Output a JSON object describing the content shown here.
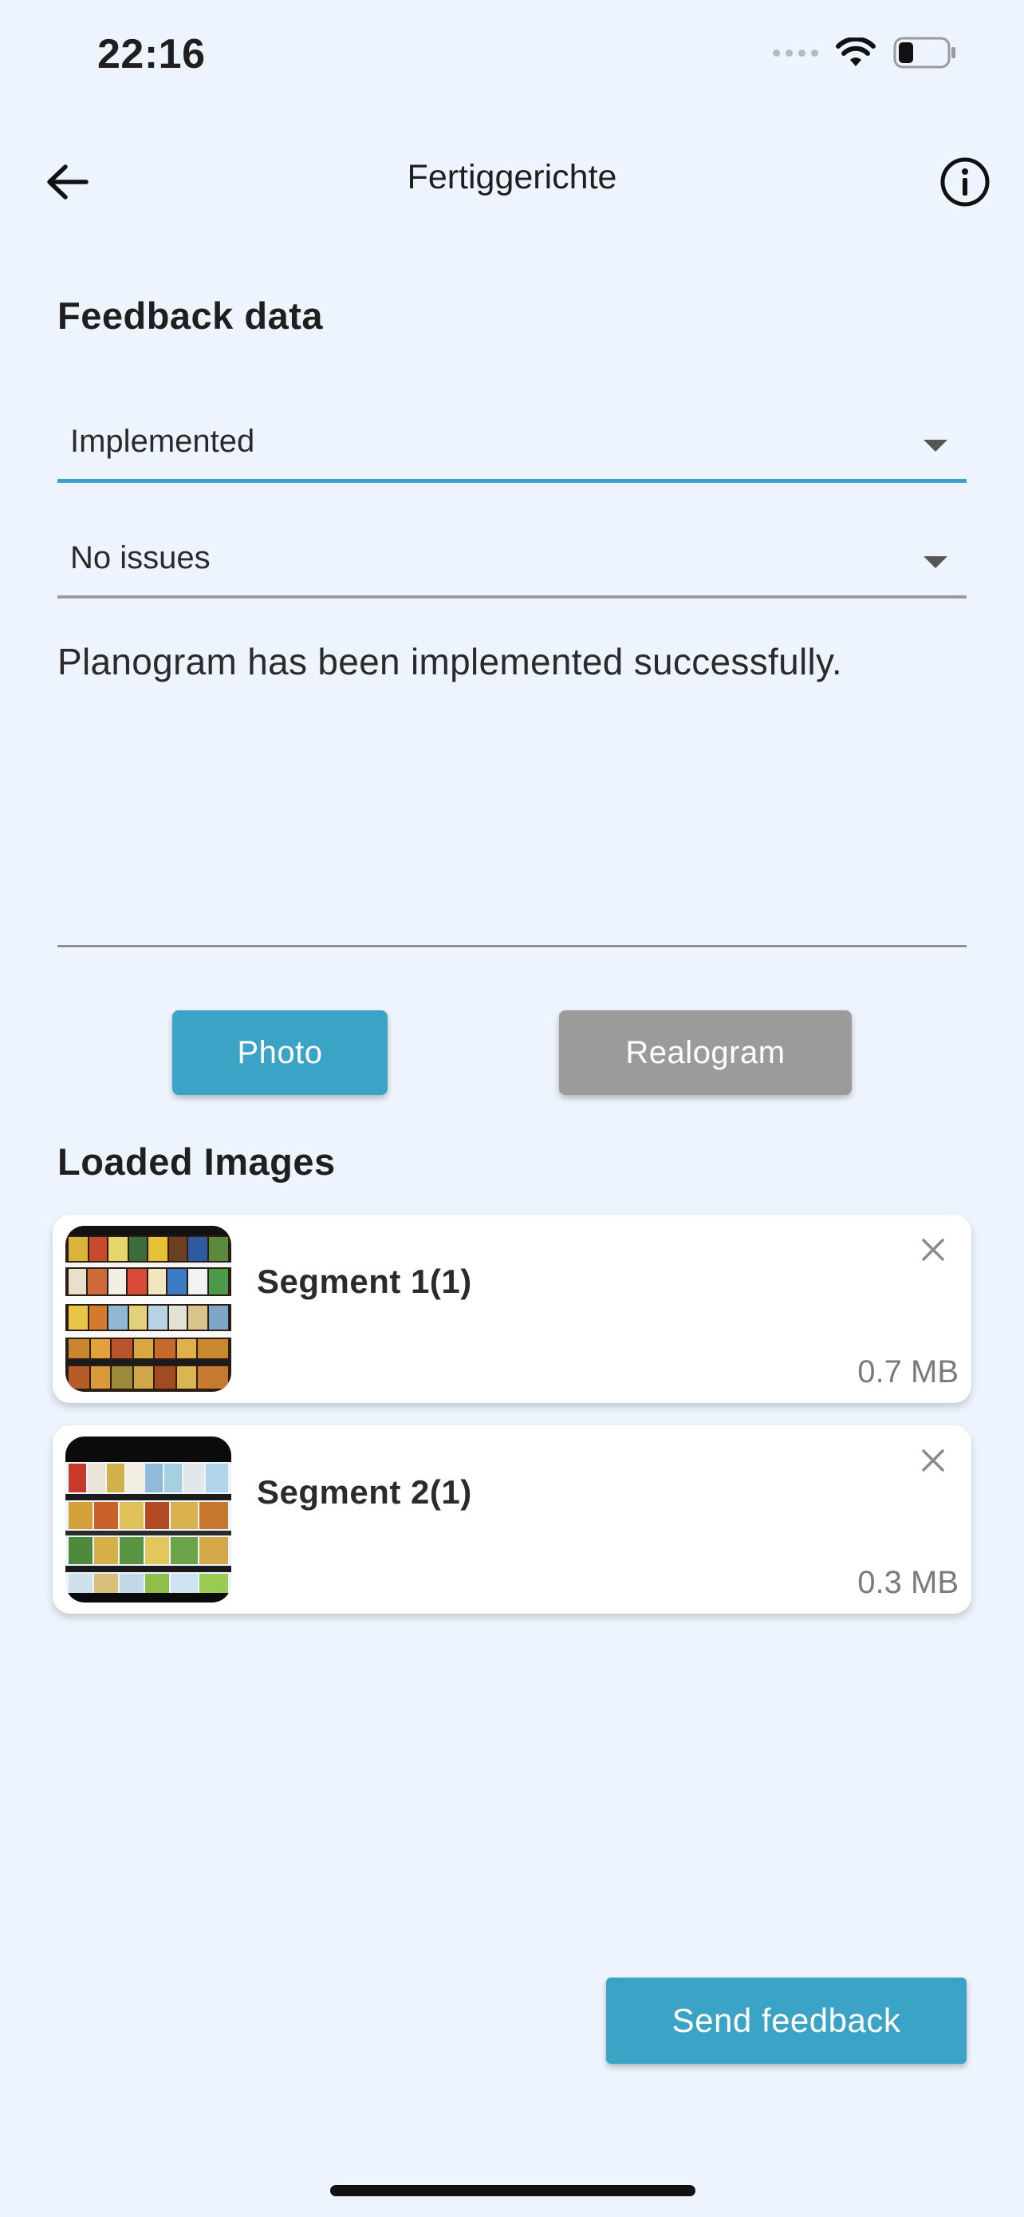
{
  "status_bar": {
    "time": "22:16",
    "signal_icon": "signal-dots-icon",
    "wifi_icon": "wifi-icon",
    "battery_icon": "battery-low-icon"
  },
  "header": {
    "back_icon": "arrow-left-icon",
    "title": "Fertiggerichte",
    "info_icon": "info-circle-icon"
  },
  "form": {
    "section_title": "Feedback data",
    "status_select": {
      "value": "Implemented",
      "accent": "#3da0c5"
    },
    "issue_select": {
      "value": "No issues"
    },
    "comment": "Planogram has been implemented successfully."
  },
  "buttons": {
    "photo": "Photo",
    "realogram": "Realogram",
    "send": "Send feedback"
  },
  "loaded_images": {
    "title": "Loaded Images",
    "items": [
      {
        "name": "Segment 1(1)",
        "size": "0.7 MB",
        "thumbnail": "shelf-photo"
      },
      {
        "name": "Segment 2(1)",
        "size": "0.3 MB",
        "thumbnail": "shelf-photo"
      }
    ]
  },
  "colors": {
    "background": "#eef4fd",
    "primary": "#3ba3c6",
    "disabled": "#9b9b9b"
  }
}
